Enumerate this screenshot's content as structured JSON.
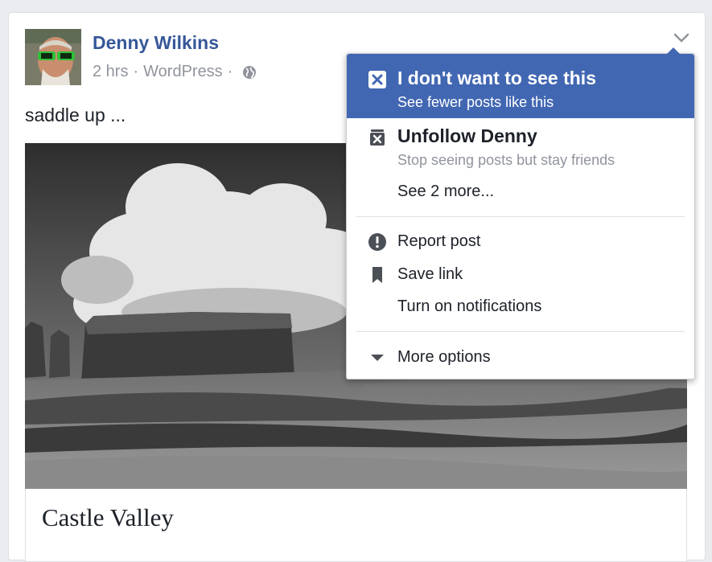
{
  "post": {
    "author": "Denny Wilkins",
    "time": "2 hrs",
    "source": "WordPress",
    "separator": "·",
    "text": "saddle up ...",
    "link_title": "Castle Valley"
  },
  "menu": {
    "hide": {
      "title": "I don't want to see this",
      "subtitle": "See fewer posts like this"
    },
    "unfollow": {
      "title": "Unfollow Denny",
      "subtitle": "Stop seeing posts but stay friends"
    },
    "see_more": "See 2 more...",
    "report": "Report post",
    "save": "Save link",
    "notifications": "Turn on notifications",
    "more_options": "More options"
  },
  "icons": {
    "audience": "globe-icon",
    "menu_toggle": "chevron-down-icon",
    "hide": "close-box-icon",
    "unfollow": "trash-x-icon",
    "report": "exclamation-icon",
    "save": "bookmark-icon",
    "more": "caret-down-icon"
  },
  "colors": {
    "author_link": "#365899",
    "menu_highlight": "#4267b2",
    "secondary_text": "#90949c",
    "primary_text": "#1d2129"
  }
}
